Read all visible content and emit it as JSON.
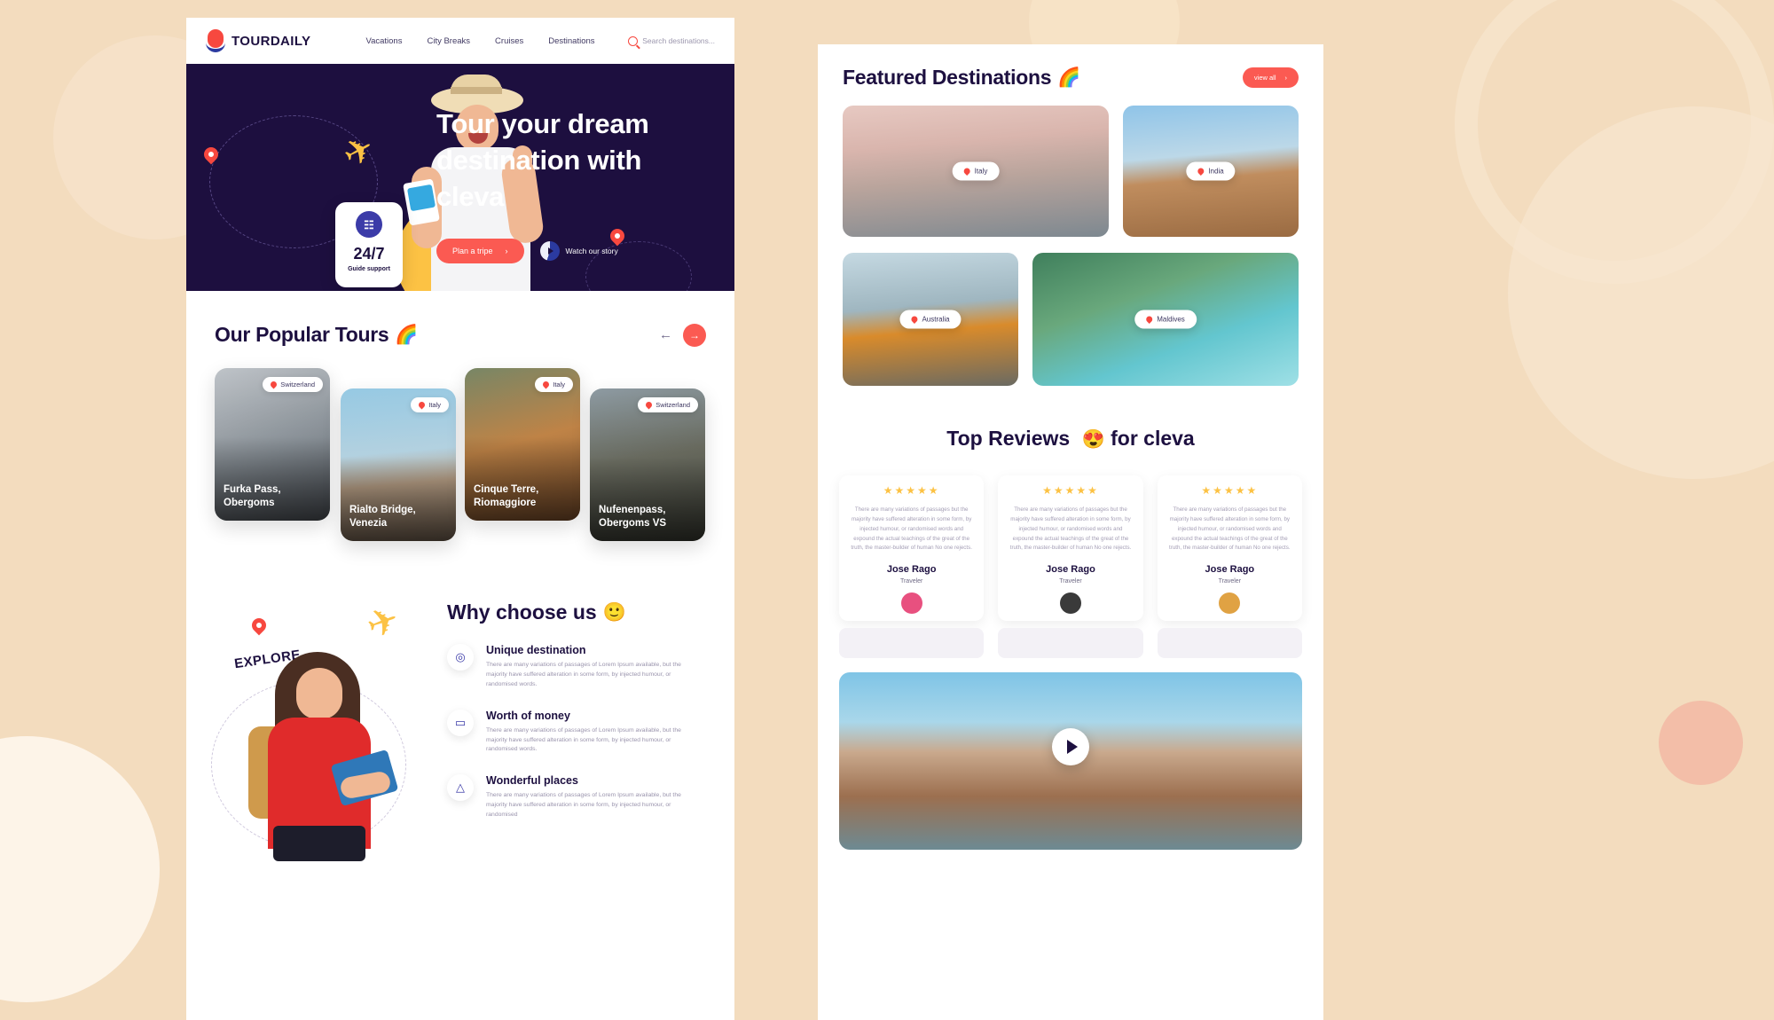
{
  "site": {
    "brand": "TOURDAILY",
    "nav": [
      "Vacations",
      "City Breaks",
      "Cruises",
      "Destinations"
    ],
    "search_placeholder": "Search destinations..."
  },
  "hero": {
    "title": "Tour your dream destination with cleva",
    "primary_button": "Plan a tripe",
    "primary_button_icon": "chevron-right",
    "watch_label": "Watch our story",
    "support_number": "24/7",
    "support_label": "Guide support"
  },
  "popular": {
    "title": "Our Popular Tours",
    "emoji": "🌈",
    "prev_icon": "←",
    "next_icon": "→",
    "cards": [
      {
        "location": "Switzerland",
        "name": "Furka Pass, Obergoms"
      },
      {
        "location": "Italy",
        "name": "Rialto Bridge, Venezia"
      },
      {
        "location": "Italy",
        "name": "Cinque Terre, Riomaggiore"
      },
      {
        "location": "Switzerland",
        "name": "Nufenenpass, Obergoms VS"
      }
    ]
  },
  "why": {
    "title": "Why choose us",
    "emoji": "🙂",
    "explore_label": "EXPLORE",
    "features": [
      {
        "icon": "location-pin-icon",
        "glyph": "◎",
        "title": "Unique destination",
        "text": "There are many variations of passages of Lorem Ipsum available, but the majority have suffered alteration in some form, by injected humour, or randomised words."
      },
      {
        "icon": "wallet-icon",
        "glyph": "▭",
        "title": "Worth of money",
        "text": "There are many variations of passages of Lorem Ipsum available, but the majority have suffered alteration in some form, by injected humour, or randomised words."
      },
      {
        "icon": "mountain-icon",
        "glyph": "△",
        "title": "Wonderful places",
        "text": "There are many variations of passages of Lorem Ipsum available, but the majority have suffered alteration in some form, by injected humour, or randomised"
      }
    ]
  },
  "featured": {
    "title": "Featured Destinations",
    "emoji": "🌈",
    "view_all": "view all",
    "view_all_icon": "chevron-right",
    "cards": [
      {
        "label": "Italy"
      },
      {
        "label": "India"
      },
      {
        "label": "Australia"
      },
      {
        "label": "Maldives"
      }
    ]
  },
  "reviews": {
    "title_pre": "Top Reviews ",
    "emoji": "😍",
    "title_post": " for cleva",
    "stars": "★★★★★",
    "items": [
      {
        "text": "There are many variations of passages but the majority have suffered alteration in some form, by injected humour, or randomised words  and expound the actual teachings of the great of the truth, the master-builder of human No one rejects.",
        "name": "Jose Rago",
        "role": "Traveler",
        "avatar_color": "#e8507f",
        "avatar_glyph": "👤"
      },
      {
        "text": "There are many variations of passages but the majority have suffered alteration in some form, by injected humour, or randomised words  and expound the actual teachings of the great of the truth, the master-builder of human No one rejects.",
        "name": "Jose Rago",
        "role": "Traveler",
        "avatar_color": "#3a3a3a",
        "avatar_glyph": "👤"
      },
      {
        "text": "There are many variations of passages but the majority have suffered alteration in some form, by injected humour, or randomised words  and expound the actual teachings of the great of the truth, the master-builder of human No one rejects.",
        "name": "Jose Rago",
        "role": "Traveler",
        "avatar_color": "#e0a243",
        "avatar_glyph": "👤"
      }
    ]
  },
  "colors": {
    "accent_red": "#fb5a52",
    "navy": "#1d1040",
    "hero_bg": "#1d0f3f",
    "yellow": "#fcc244",
    "page_bg": "#f3dcbe"
  }
}
